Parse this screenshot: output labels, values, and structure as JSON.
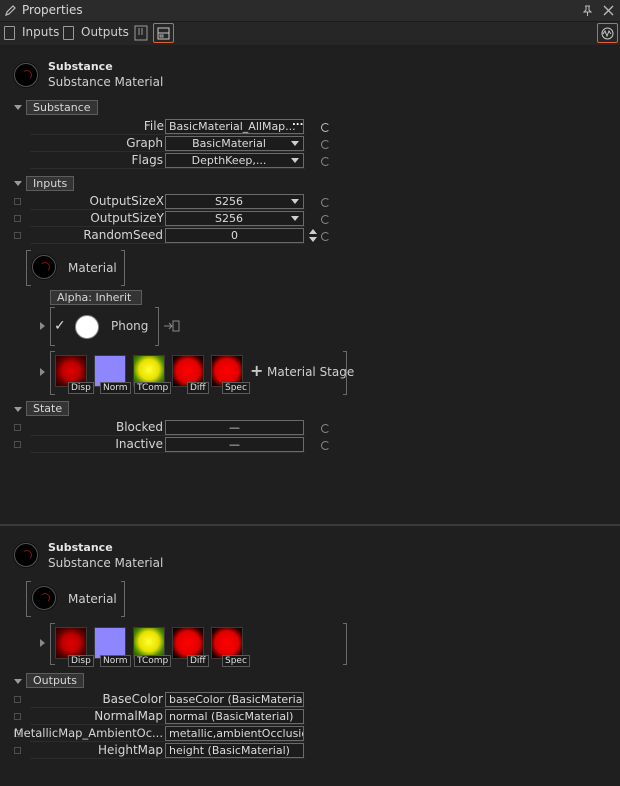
{
  "window": {
    "title": "Properties"
  },
  "toolbar": {
    "inputs_label": "Inputs",
    "outputs_label": "Outputs"
  },
  "colors": {
    "accent": "#e0642a",
    "background": "#1f1f1f"
  },
  "panel1": {
    "header": {
      "title": "Substance",
      "subtitle": "Substance Material"
    },
    "sections": {
      "substance": "Substance",
      "inputs": "Inputs",
      "state": "State"
    },
    "substance_rows": [
      {
        "label": "File",
        "value": "BasicMaterial_AllMap..."
      },
      {
        "label": "Graph",
        "value": "BasicMaterial"
      },
      {
        "label": "Flags",
        "value": "DepthKeep,..."
      }
    ],
    "input_rows": [
      {
        "label": "OutputSizeX",
        "value": "S256"
      },
      {
        "label": "OutputSizeY",
        "value": "S256"
      },
      {
        "label": "RandomSeed",
        "value": "0"
      }
    ],
    "material": {
      "label": "Material",
      "alpha_label": "Alpha:  Inherit",
      "phong_label": "Phong",
      "stage_label": "Material Stage"
    },
    "thumbnails": [
      "Disp",
      "Norm",
      "TComp",
      "Diff",
      "Spec"
    ],
    "state_rows": [
      {
        "label": "Blocked",
        "value": "—"
      },
      {
        "label": "Inactive",
        "value": "—"
      }
    ]
  },
  "panel2": {
    "header": {
      "title": "Substance",
      "subtitle": "Substance Material"
    },
    "material": {
      "label": "Material"
    },
    "thumbnails": [
      "Disp",
      "Norm",
      "TComp",
      "Diff",
      "Spec"
    ],
    "sections": {
      "outputs": "Outputs"
    },
    "output_rows": [
      {
        "label": "BaseColor",
        "value": "baseColor (BasicMaterial)"
      },
      {
        "label": "NormalMap",
        "value": "normal (BasicMaterial)"
      },
      {
        "label": "MetallicMap_AmbientOc...",
        "value": "metallic,ambientOcclusio..."
      },
      {
        "label": "HeightMap",
        "value": "height (BasicMaterial)"
      }
    ]
  }
}
